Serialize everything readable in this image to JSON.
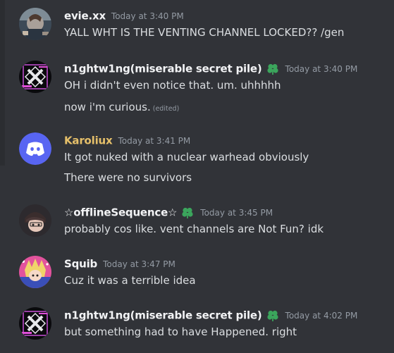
{
  "messages": [
    {
      "author": "evie.xx",
      "timestamp": "Today at 3:40 PM",
      "lines": [
        "YALL WHT IS THE VENTING CHANNEL LOCKED?? /gen"
      ]
    },
    {
      "author": "n1ghtw1ng(miserable secret pile)",
      "timestamp": "Today at 3:40 PM",
      "badge": "four-leaf-clover-icon",
      "lines": [
        "OH i didn't even notice that. um. uhhhhh",
        "now i'm curious."
      ],
      "edited_label": "(edited)"
    },
    {
      "author": "Karoliux",
      "timestamp": "Today at 3:41 PM",
      "name_color": "#e6c06a",
      "lines": [
        "It got nuked with a nuclear warhead obviously",
        "There were no survivors"
      ]
    },
    {
      "author": "☆offlineSequence☆",
      "timestamp": "Today at 3:45 PM",
      "badge": "four-leaf-clover-icon",
      "lines": [
        "probably cos like. vent channels are Not Fun? idk"
      ]
    },
    {
      "author": "Squib",
      "timestamp": "Today at 3:47 PM",
      "lines": [
        "Cuz it was a terrible idea"
      ]
    },
    {
      "author": "n1ghtw1ng(miserable secret pile)",
      "timestamp": "Today at 4:02 PM",
      "badge": "four-leaf-clover-icon",
      "lines": [
        "but something had to have Happened. right"
      ]
    }
  ],
  "colors": {
    "background": "#313338",
    "text": "#dbdee1",
    "username": "#f2f3f5",
    "timestamp": "#949ba4",
    "badge_green": "#3ba55c",
    "discord_blurple": "#5865f2"
  }
}
